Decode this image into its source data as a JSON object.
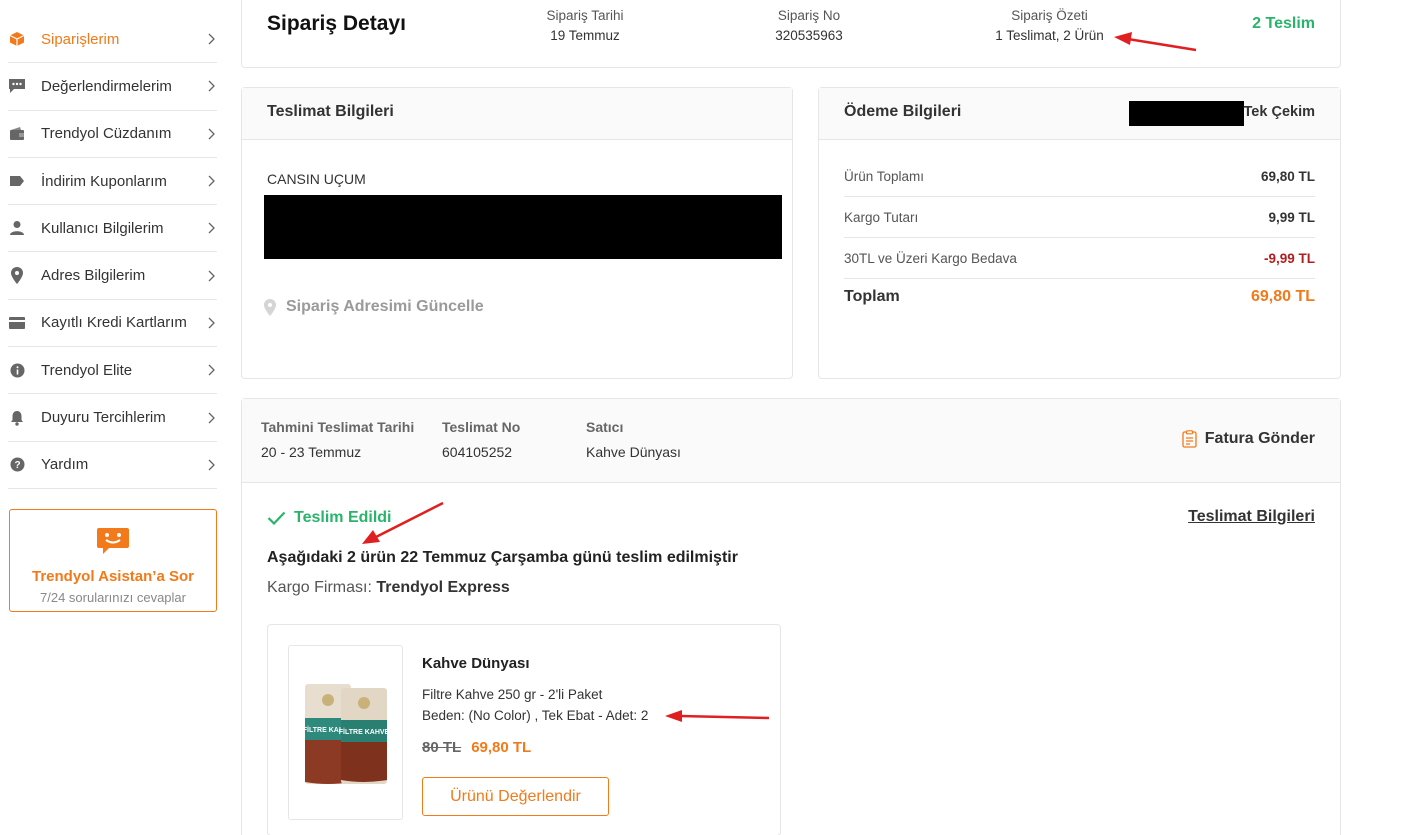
{
  "sidebar": {
    "items": [
      {
        "label": "Siparişlerim",
        "icon": "box-icon",
        "active": true
      },
      {
        "label": "Değerlendirmelerim",
        "icon": "chat-icon",
        "active": false
      },
      {
        "label": "Trendyol Cüzdanım",
        "icon": "wallet-icon",
        "active": false
      },
      {
        "label": "İndirim Kuponlarım",
        "icon": "tag-icon",
        "active": false
      },
      {
        "label": "Kullanıcı Bilgilerim",
        "icon": "user-icon",
        "active": false
      },
      {
        "label": "Adres Bilgilerim",
        "icon": "pin-icon",
        "active": false
      },
      {
        "label": "Kayıtlı Kredi Kartlarım",
        "icon": "card-icon",
        "active": false
      },
      {
        "label": "Trendyol Elite",
        "icon": "info-icon",
        "active": false
      },
      {
        "label": "Duyuru Tercihlerim",
        "icon": "bell-icon",
        "active": false
      },
      {
        "label": "Yardım",
        "icon": "help-icon",
        "active": false
      }
    ],
    "assistant": {
      "title": "Trendyol Asistan’a Sor",
      "subtitle": "7/24 sorularınızı cevaplar"
    }
  },
  "header": {
    "title": "Sipariş Detayı",
    "order_date_label": "Sipariş Tarihi",
    "order_date": "19 Temmuz",
    "order_no_label": "Sipariş No",
    "order_no": "320535963",
    "summary_label": "Sipariş Özeti",
    "summary": "1 Teslimat, 2 Ürün",
    "delivered_count": "2 Teslim"
  },
  "delivery": {
    "title": "Teslimat Bilgileri",
    "recipient": "CANSIN UÇUM",
    "update_address": "Sipariş Adresimi Güncelle"
  },
  "payment": {
    "title": "Ödeme Bilgileri",
    "type": "Tek Çekim",
    "rows": [
      {
        "label": "Ürün Toplamı",
        "value": "69,80 TL"
      },
      {
        "label": "Kargo Tutarı",
        "value": "9,99 TL"
      },
      {
        "label": "30TL ve Üzeri Kargo Bedava",
        "value": "-9,99 TL"
      }
    ],
    "total_label": "Toplam",
    "total_value": "69,80 TL"
  },
  "shipment": {
    "est_date_label": "Tahmini Teslimat Tarihi",
    "est_date": "20 - 23 Temmuz",
    "delivery_no_label": "Teslimat No",
    "delivery_no": "604105252",
    "seller_label": "Satıcı",
    "seller": "Kahve Dünyası",
    "invoice_button": "Fatura Gönder",
    "status": "Teslim Edildi",
    "delivery_info_link": "Teslimat Bilgileri",
    "delivered_message": "Aşağıdaki 2 ürün 22 Temmuz Çarşamba günü teslim edilmiştir",
    "carrier_label": "Kargo Firması:",
    "carrier": "Trendyol Express"
  },
  "product": {
    "brand": "Kahve Dünyası",
    "name": "Filtre Kahve 250 gr - 2'li Paket",
    "variant": "Beden: (No Color) , Tek Ebat - Adet: 2",
    "old_price": "80 TL",
    "new_price": "69,80 TL",
    "rate_button": "Ürünü Değerlendir",
    "package_text": "FİLTRE KAHVE"
  },
  "colors": {
    "accent": "#f27a1a",
    "success": "#2ab46b",
    "negative": "#b01e1e",
    "annotation": "#e02020"
  }
}
